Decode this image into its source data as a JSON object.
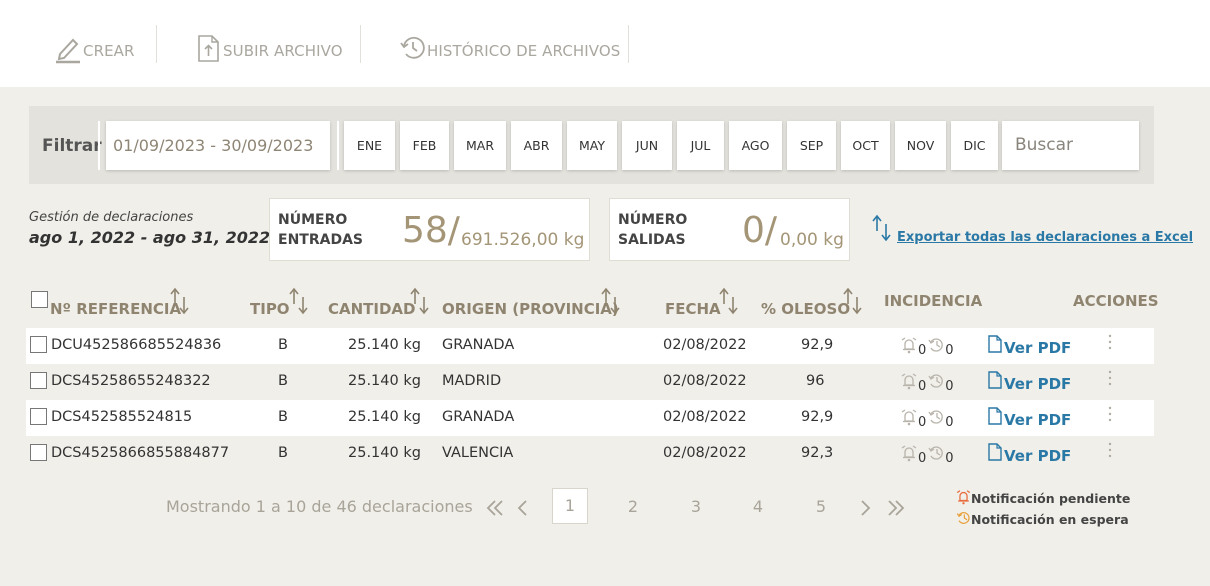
{
  "toolbar": {
    "create_label": "CREAR",
    "upload_label": "SUBIR ARCHIVO",
    "history_label": "HISTÓRICO DE ARCHIVOS"
  },
  "filter": {
    "label": "Filtrar",
    "date_range": "01/09/2023 - 30/09/2023",
    "months": [
      "ENE",
      "FEB",
      "MAR",
      "ABR",
      "MAY",
      "JUN",
      "JUL",
      "AGO",
      "SEP",
      "OCT",
      "NOV",
      "DIC"
    ],
    "search_placeholder": "Buscar"
  },
  "summary": {
    "title": "Gestión de declaraciones",
    "range": "ago 1, 2022 - ago 31, 2022",
    "entradas_label_1": "NÚMERO",
    "entradas_label_2": "ENTRADAS",
    "entradas_count": "58/",
    "entradas_amount": "691.526,00 kg",
    "salidas_label_1": "NÚMERO",
    "salidas_label_2": "SALIDAS",
    "salidas_count": "0/",
    "salidas_amount": "0,00 kg",
    "export_label": "Exportar todas las declaraciones a Excel"
  },
  "table": {
    "headers": {
      "ref": "Nº REFERENCIA",
      "tipo": "TIPO",
      "cantidad": "CANTIDAD",
      "origen": "ORIGEN (PROVINCIA)",
      "fecha": "FECHA",
      "oleoso": "% OLEOSO",
      "incidencia": "INCIDENCIA",
      "acciones": "ACCIONES"
    },
    "pdf_label": "Ver PDF",
    "rows": [
      {
        "ref": "DCU452586685524836",
        "tipo": "B",
        "cantidad": "25.140 kg",
        "origen": "GRANADA",
        "fecha": "02/08/2022",
        "oleoso": "92,9",
        "pend": "0",
        "espera": "0"
      },
      {
        "ref": "DCS45258655248322",
        "tipo": "B",
        "cantidad": "25.140 kg",
        "origen": "MADRID",
        "fecha": "02/08/2022",
        "oleoso": "96",
        "pend": "0",
        "espera": "0"
      },
      {
        "ref": "DCS452585524815",
        "tipo": "B",
        "cantidad": "25.140 kg",
        "origen": "GRANADA",
        "fecha": "02/08/2022",
        "oleoso": "92,9",
        "pend": "0",
        "espera": "0"
      },
      {
        "ref": "DCS4525866855884877",
        "tipo": "B",
        "cantidad": "25.140 kg",
        "origen": "VALENCIA",
        "fecha": "02/08/2022",
        "oleoso": "92,3",
        "pend": "0",
        "espera": "0"
      }
    ]
  },
  "pagination": {
    "info": "Mostrando 1 a 10 de 46 declaraciones",
    "pages": [
      "1",
      "2",
      "3",
      "4",
      "5"
    ],
    "current": "1"
  },
  "legend": {
    "pending": "Notificación pendiente",
    "waiting": "Notificación en espera"
  },
  "colors": {
    "accent_blue": "#2a78a6",
    "gold": "#a39576",
    "alert_orange": "#e86a3a"
  }
}
